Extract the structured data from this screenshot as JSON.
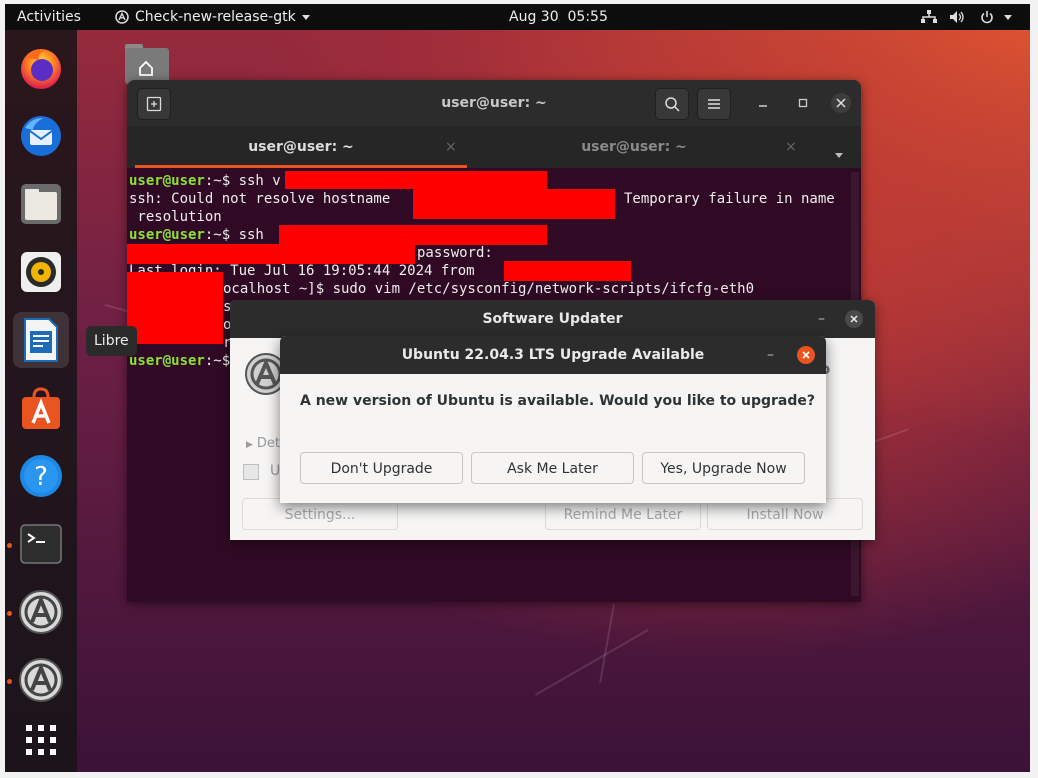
{
  "topbar": {
    "activities": "Activities",
    "app_menu": "Check-new-release-gtk",
    "clock": "Aug 30  05:55"
  },
  "dock": {
    "items": [
      {
        "name": "firefox"
      },
      {
        "name": "thunderbird"
      },
      {
        "name": "files"
      },
      {
        "name": "rhythmbox"
      },
      {
        "name": "libreoffice-writer"
      },
      {
        "name": "ubuntu-software"
      },
      {
        "name": "help"
      },
      {
        "name": "terminal"
      },
      {
        "name": "software-updater-1"
      },
      {
        "name": "software-updater-2"
      },
      {
        "name": "show-applications"
      }
    ],
    "tooltip": "Libre"
  },
  "terminal": {
    "title": "user@user: ~",
    "tabs": [
      {
        "label": "user@user: ~",
        "active": true
      },
      {
        "label": "user@user: ~",
        "active": false
      }
    ],
    "lines": {
      "l1_prompt": "user@user",
      "l1_rest": ":~$ ssh v",
      "l2a": "ssh: Could not resolve hostname",
      "l2b": "Temporary failure in name",
      "l3": " resolution",
      "l4_prompt": "user@user",
      "l4_rest": ":~$ ssh",
      "l5": "password:",
      "l6": "Last login: Tue Jul 16 19:05:44 2024 from",
      "l7": "ocalhost ~]$ sudo vim /etc/sysconfig/network-scripts/ifcfg-eth0",
      "l8": "s",
      "l9": "o",
      "l10": "r",
      "l11_prompt": "user@user",
      "l11_rest": ":~$"
    }
  },
  "updater": {
    "title": "Software Updater",
    "details_label": "Det",
    "row_label": "U",
    "settings_button": "Settings...",
    "remind_button": "Remind Me Later",
    "install_button": "Install Now",
    "partial_char": "o"
  },
  "dialog": {
    "title": "Ubuntu 22.04.3 LTS Upgrade Available",
    "message": "A new version of Ubuntu is available. Would you like to upgrade?",
    "buttons": {
      "dont_upgrade": "Don't Upgrade",
      "ask_later": "Ask Me Later",
      "upgrade_now": "Yes, Upgrade Now"
    }
  },
  "colors": {
    "accent": "#e95420",
    "prompt_green": "#8ae234",
    "redaction": "#ff0000"
  }
}
